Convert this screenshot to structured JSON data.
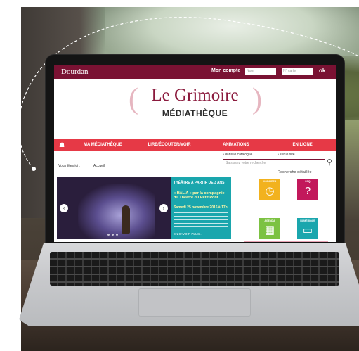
{
  "site": {
    "logo_text": "Dourdan",
    "account_label": "Mon compte",
    "login_placeholder": "Nom",
    "card_placeholder": "N° carte",
    "ok_label": "ok",
    "brand_title": "Le Grimoire",
    "brand_subtitle": "MÉDIATHÈQUE",
    "nav": [
      "MA MÉDIATHÈQUE",
      "LIRE/ÉCOUTER/VOIR",
      "ANIMATIONS",
      "EN LIGNE"
    ],
    "search_option_catalog": "• dans le catalogue",
    "search_option_site": "• sur le site",
    "search_placeholder": "Saisissez votre recherche",
    "advanced_search": "Recherche détaillée",
    "breadcrumb_label": "Vous êtes ici :",
    "breadcrumb_current": "Accueil",
    "news_header": "THÉÂTRE À PARTIR DE 3 ANS",
    "news_title": "« HALIA » par la compagnie du Théâtre du Petit Pont",
    "news_date": "Samedi 25 novembre 2016 à 17h",
    "news_more": "EN SAVOIR PLUS...",
    "tiles": [
      {
        "label": "HORAIRES",
        "icon": "clock-icon"
      },
      {
        "label": "FAQ",
        "icon": "question-icon"
      },
      {
        "label": "AGENDA",
        "icon": "calendar-icon"
      },
      {
        "label": "NUMÉRIQUE",
        "icon": "tablet-icon"
      }
    ]
  },
  "colors": {
    "maroon": "#7a1233",
    "nav_red": "#e63946",
    "teal": "#1aa6ad",
    "yellow": "#f2b21e",
    "magenta": "#c2185b",
    "green": "#7cc242"
  }
}
